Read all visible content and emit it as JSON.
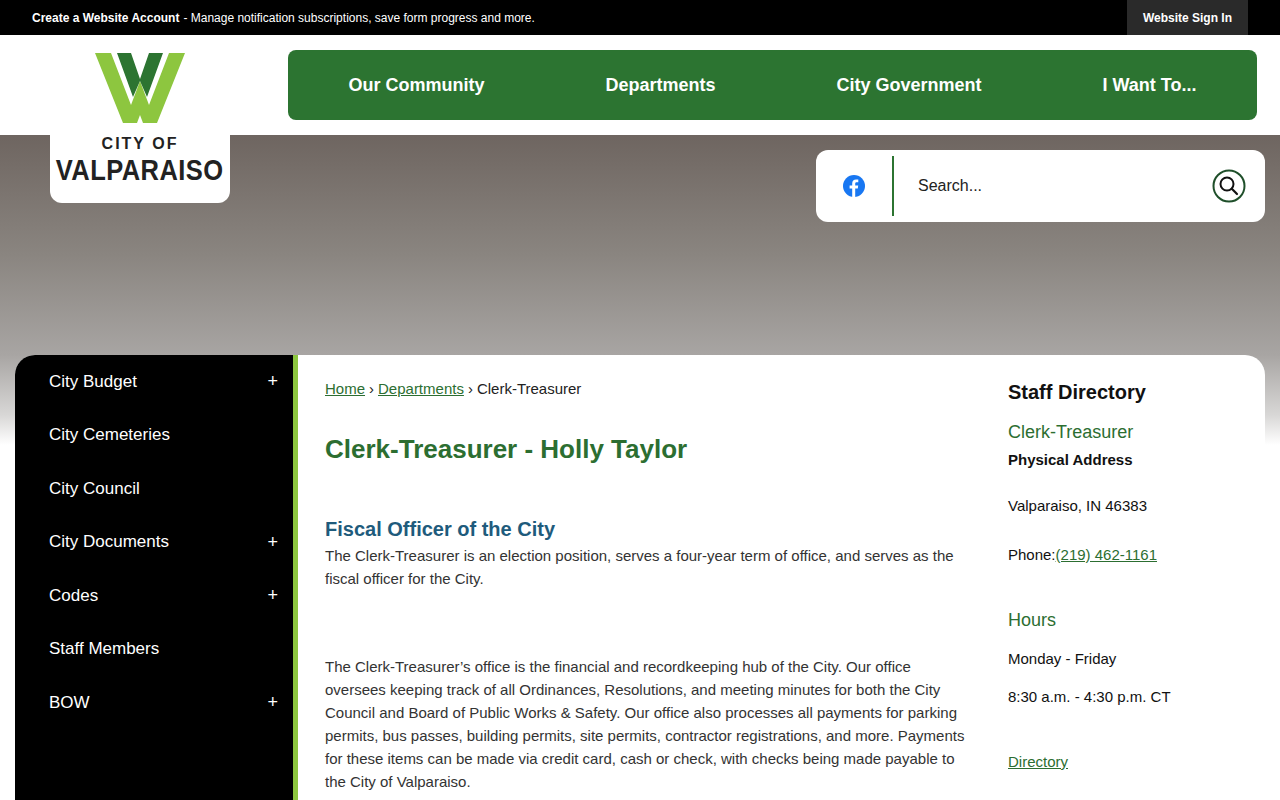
{
  "top_bar": {
    "account_link": "Create a Website Account",
    "account_text": "- Manage notification subscriptions, save form progress and more.",
    "sign_in": "Website Sign In"
  },
  "logo": {
    "line1": "CITY OF",
    "line2": "VALPARAISO"
  },
  "nav": [
    "Our Community",
    "Departments",
    "City Government",
    "I Want To..."
  ],
  "search": {
    "placeholder": "Search..."
  },
  "sidebar": {
    "expand_glyph": "+",
    "items": [
      {
        "label": "City Budget",
        "expandable": true
      },
      {
        "label": "City Cemeteries",
        "expandable": false
      },
      {
        "label": "City Council",
        "expandable": false
      },
      {
        "label": "City Documents",
        "expandable": true
      },
      {
        "label": "Codes",
        "expandable": true
      },
      {
        "label": "Staff Members",
        "expandable": false
      },
      {
        "label": "BOW",
        "expandable": true
      }
    ]
  },
  "breadcrumb": {
    "separator": "›",
    "items": [
      {
        "label": "Home",
        "link": true
      },
      {
        "label": "Departments",
        "link": true
      },
      {
        "label": "Clerk-Treasurer",
        "link": false
      }
    ]
  },
  "page": {
    "title": "Clerk-Treasurer - Holly Taylor",
    "subheading": "Fiscal Officer of the City",
    "paragraphs": [
      "The Clerk-Treasurer is an election position, serves a four-year term of office, and serves as the fiscal officer for the City.",
      "The Clerk-Treasurer’s office is the financial and recordkeeping hub of the City.  Our office oversees keeping track of all Ordinances, Resolutions, and meeting minutes for both the City Council and Board of Public Works & Safety.  Our office also processes all payments for parking permits, bus passes, building permits, site permits, contractor registrations, and more.  Payments for these items can be made via credit card, cash or check, with checks being made payable to the City of Valparaiso."
    ]
  },
  "staff_directory": {
    "title": "Staff Directory",
    "department": "Clerk-Treasurer",
    "address_label": "Physical Address",
    "address": "Valparaiso, IN 46383",
    "phone_label": "Phone:",
    "phone": "(219) 462-1161",
    "hours_title": "Hours",
    "days": "Monday - Friday",
    "hours": "8:30 a.m. - 4:30 p.m. CT",
    "directory_link": "Directory"
  }
}
